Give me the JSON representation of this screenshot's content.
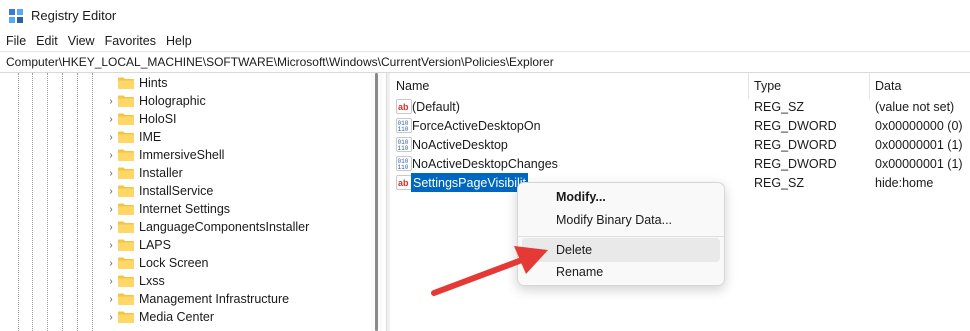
{
  "window": {
    "title": "Registry Editor",
    "icon": "registry-editor-icon"
  },
  "menu": [
    "File",
    "Edit",
    "View",
    "Favorites",
    "Help"
  ],
  "address": "Computer\\HKEY_LOCAL_MACHINE\\SOFTWARE\\Microsoft\\Windows\\CurrentVersion\\Policies\\Explorer",
  "tree": {
    "items": [
      {
        "label": "Hints",
        "expandable": false
      },
      {
        "label": "Holographic",
        "expandable": true
      },
      {
        "label": "HoloSI",
        "expandable": true
      },
      {
        "label": "IME",
        "expandable": true
      },
      {
        "label": "ImmersiveShell",
        "expandable": true
      },
      {
        "label": "Installer",
        "expandable": true
      },
      {
        "label": "InstallService",
        "expandable": true
      },
      {
        "label": "Internet Settings",
        "expandable": true
      },
      {
        "label": "LanguageComponentsInstaller",
        "expandable": true
      },
      {
        "label": "LAPS",
        "expandable": true
      },
      {
        "label": "Lock Screen",
        "expandable": true
      },
      {
        "label": "Lxss",
        "expandable": true
      },
      {
        "label": "Management Infrastructure",
        "expandable": true
      },
      {
        "label": "Media Center",
        "expandable": true
      }
    ]
  },
  "list": {
    "columns": {
      "name": "Name",
      "type": "Type",
      "data": "Data"
    },
    "rows": [
      {
        "name": "(Default)",
        "type": "REG_SZ",
        "data": "(value not set)",
        "icon": "string-value-icon",
        "selected": false
      },
      {
        "name": "ForceActiveDesktopOn",
        "type": "REG_DWORD",
        "data": "0x00000000 (0)",
        "icon": "binary-value-icon",
        "selected": false
      },
      {
        "name": "NoActiveDesktop",
        "type": "REG_DWORD",
        "data": "0x00000001 (1)",
        "icon": "binary-value-icon",
        "selected": false
      },
      {
        "name": "NoActiveDesktopChanges",
        "type": "REG_DWORD",
        "data": "0x00000001 (1)",
        "icon": "binary-value-icon",
        "selected": false
      },
      {
        "name": "SettingsPageVisibilit",
        "type": "REG_SZ",
        "data": "hide:home",
        "icon": "string-value-icon",
        "selected": true
      }
    ]
  },
  "context_menu": {
    "items": [
      {
        "label": "Modify...",
        "bold": true
      },
      {
        "label": "Modify Binary Data...",
        "bold": false
      },
      {
        "label": "Delete",
        "bold": false,
        "hover": true
      },
      {
        "label": "Rename",
        "bold": false
      }
    ]
  },
  "colors": {
    "selection": "#0067c0",
    "folder": "#f4c542",
    "arrow": "#e53935"
  }
}
